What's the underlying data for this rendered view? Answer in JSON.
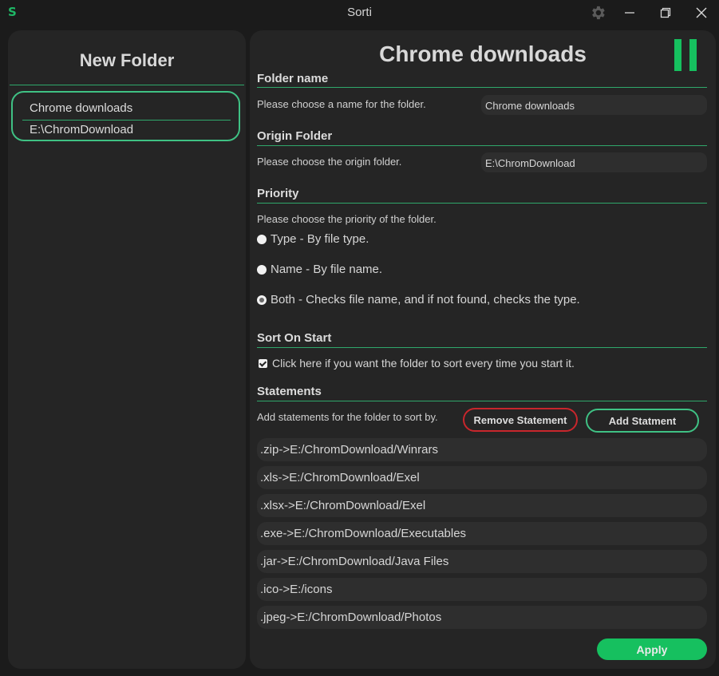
{
  "window": {
    "logo": "S",
    "title": "Sorti"
  },
  "sidebar": {
    "title": "New Folder",
    "folders": [
      {
        "name": "Chrome downloads",
        "path": "E:\\ChromDownload"
      }
    ]
  },
  "main": {
    "title": "Chrome downloads",
    "folder_name": {
      "heading": "Folder name",
      "description": "Please choose a name for the folder.",
      "value": "Chrome downloads"
    },
    "origin_folder": {
      "heading": "Origin Folder",
      "description": "Please choose the origin folder.",
      "value": "E:\\ChromDownload"
    },
    "priority": {
      "heading": "Priority",
      "description": "Please choose the priority of the folder.",
      "options": [
        {
          "label": "Type - By file type.",
          "checked": false
        },
        {
          "label": "Name - By file name.",
          "checked": false
        },
        {
          "label": "Both - Checks file name, and if not found, checks the type.",
          "checked": true
        }
      ]
    },
    "sort_on_start": {
      "heading": "Sort On Start",
      "label": "Click here if you want the folder to sort every time you start it.",
      "checked": true
    },
    "statements": {
      "heading": "Statements",
      "description": "Add statements for the folder to sort by.",
      "remove_label": "Remove Statement",
      "add_label": "Add Statment",
      "items": [
        ".zip->E:/ChromDownload/Winrars",
        ".xls->E:/ChromDownload/Exel",
        ".xlsx->E:/ChromDownload/Exel",
        ".exe->E:/ChromDownload/Executables",
        ".jar->E:/ChromDownload/Java Files",
        ".ico->E:/icons",
        ".jpeg->E:/ChromDownload/Photos"
      ]
    },
    "apply_label": "Apply"
  },
  "colors": {
    "accent": "#16c05f",
    "accent_border": "#3fc184",
    "danger": "#c8262c",
    "panel": "#252525",
    "background": "#1b1b1b"
  }
}
